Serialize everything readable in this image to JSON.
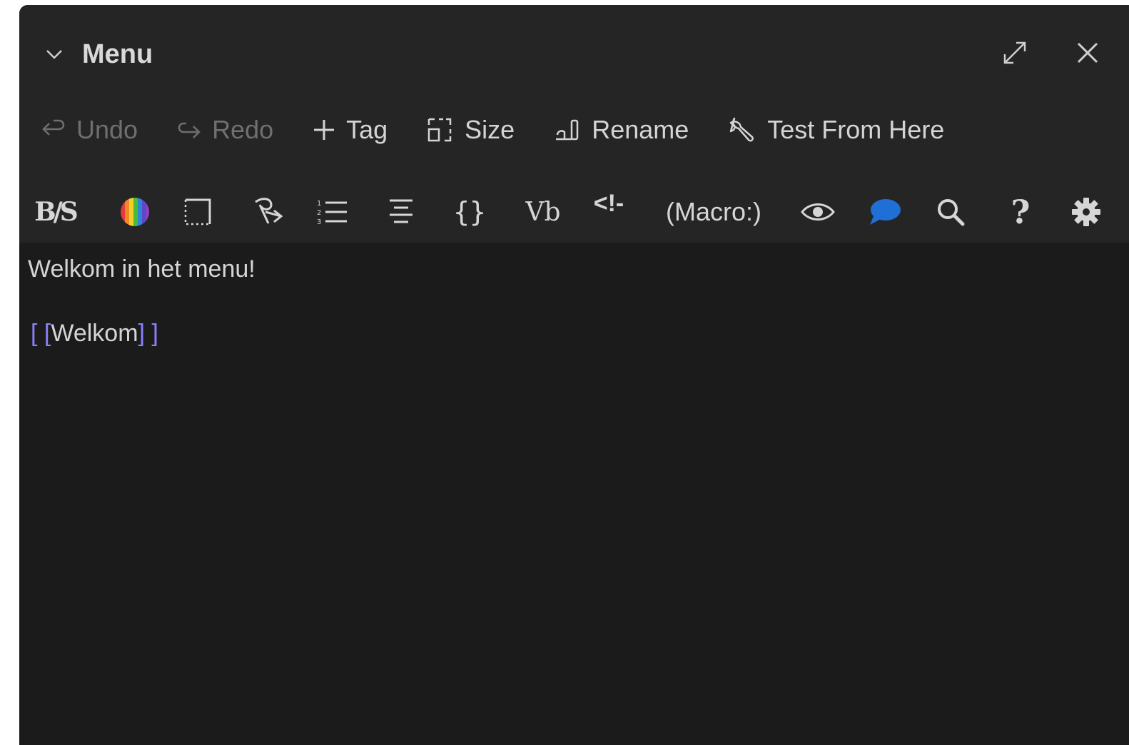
{
  "panel": {
    "title": "Menu"
  },
  "toolbar_primary": {
    "undo": "Undo",
    "redo": "Redo",
    "tag": "Tag",
    "size": "Size",
    "rename": "Rename",
    "test_from_here": "Test From Here"
  },
  "toolbar_format": {
    "bold_strike": "B/S",
    "braces": "{}",
    "vb": "Vb",
    "comment": "<!-",
    "macro": "(Macro:)",
    "help": "?"
  },
  "passage": {
    "line1": "Welkom in het menu!",
    "link_open": "[ [",
    "link_text": "Welkom",
    "link_close": "] ]"
  },
  "colors": {
    "panel_bg": "#1b1b1b",
    "header_bg": "#252525",
    "link_bracket": "#8a7fff",
    "comment_bubble": "#1f6fd6"
  },
  "icons": [
    "chevron-down-icon",
    "maximize-icon",
    "close-icon",
    "undo-icon",
    "redo-icon",
    "plus-icon",
    "size-icon",
    "rename-icon",
    "wrench-icon",
    "rainbow-color-icon",
    "border-icon",
    "rotate-icon",
    "list-icon",
    "align-center-icon",
    "eye-icon",
    "speech-bubble-icon",
    "search-icon",
    "gear-icon"
  ]
}
